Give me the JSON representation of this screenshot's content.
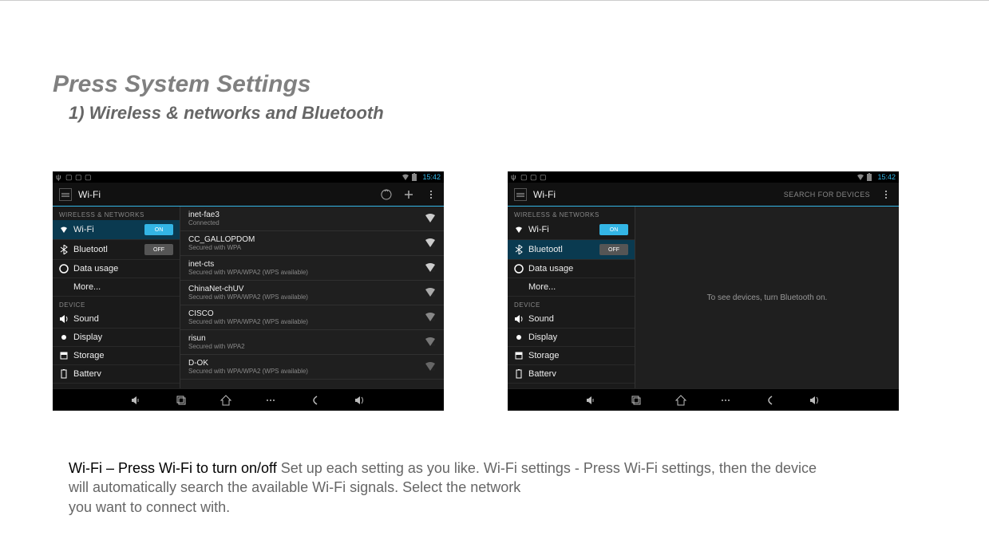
{
  "heading": "Press System Settings",
  "subheading": "1) Wireless & networks and Bluetooth",
  "description": {
    "strong": "Wi-Fi – Press Wi-Fi to turn on/off",
    "line1_rest": " Set up each setting as you like. Wi-Fi settings - Press Wi-Fi settings, then the device",
    "line2": "will automatically search the available Wi-Fi signals. Select the network",
    "line3": "you want to connect with."
  },
  "shot1": {
    "time": "15:42",
    "title": "Wi-Fi",
    "search_for_devices": "",
    "sidebar": {
      "h1": "WIRELESS & NETWORKS",
      "wifi": "Wi-Fi",
      "wifi_toggle": "ON",
      "bt": "Bluetootl",
      "bt_toggle": "OFF",
      "data": "Data usage",
      "more": "More...",
      "h2": "DEVICE",
      "sound": "Sound",
      "display": "Display",
      "storage": "Storage",
      "battery": "Batterv"
    },
    "networks": [
      {
        "name": "inet-fae3",
        "sub": "Connected"
      },
      {
        "name": "CC_GALLOPDOM",
        "sub": "Secured with WPA"
      },
      {
        "name": "inet-cts",
        "sub": "Secured with WPA/WPA2 (WPS available)"
      },
      {
        "name": "ChinaNet-chUV",
        "sub": "Secured with WPA/WPA2 (WPS available)"
      },
      {
        "name": "CISCO",
        "sub": "Secured with WPA/WPA2 (WPS available)"
      },
      {
        "name": "risun",
        "sub": "Secured with WPA2"
      },
      {
        "name": "D-OK",
        "sub": "Secured with WPA/WPA2 (WPS available)"
      }
    ]
  },
  "shot2": {
    "time": "15:42",
    "title": "Wi-Fi",
    "search_for_devices": "SEARCH FOR DEVICES",
    "sidebar": {
      "h1": "WIRELESS & NETWORKS",
      "wifi": "Wi-Fi",
      "wifi_toggle": "ON",
      "bt": "Bluetootl",
      "bt_toggle": "OFF",
      "data": "Data usage",
      "more": "More...",
      "h2": "DEVICE",
      "sound": "Sound",
      "display": "Display",
      "storage": "Storage",
      "battery": "Batterv"
    },
    "empty_msg": "To see devices, turn Bluetooth on."
  }
}
